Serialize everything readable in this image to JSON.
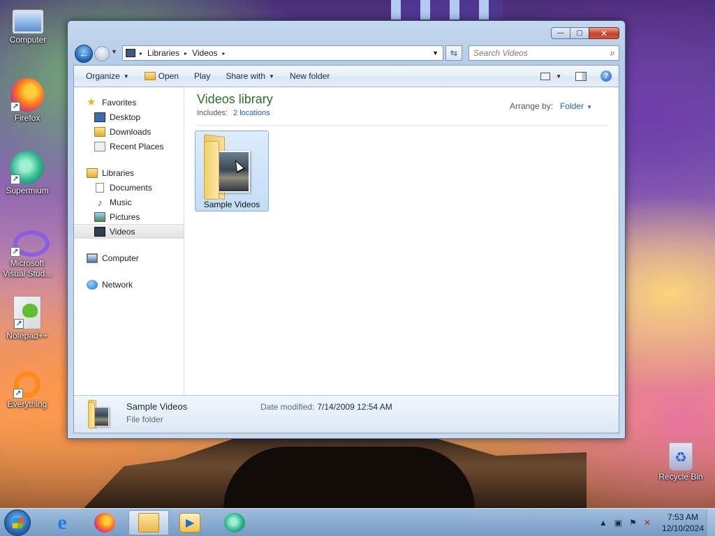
{
  "desktop": {
    "icons": [
      {
        "label": "Computer",
        "icon": "computer-icon"
      },
      {
        "label": "Firefox",
        "icon": "firefox-icon"
      },
      {
        "label": "Supermium",
        "icon": "supermium-icon"
      },
      {
        "label": "Microsoft Visual Stud...",
        "icon": "visual-studio-icon"
      },
      {
        "label": "Notepad++",
        "icon": "notepadpp-icon"
      },
      {
        "label": "Everything",
        "icon": "everything-icon"
      },
      {
        "label": "Recycle Bin",
        "icon": "recycle-bin-icon"
      }
    ]
  },
  "window": {
    "caption_buttons": {
      "minimize": "—",
      "maximize": "▢",
      "close": "✕"
    },
    "address": {
      "crumbs": [
        "Libraries",
        "Videos"
      ],
      "separator": "▸"
    },
    "search": {
      "placeholder": "Search Videos"
    },
    "toolbar": {
      "organize": "Organize",
      "open": "Open",
      "play": "Play",
      "share_with": "Share with",
      "new_folder": "New folder"
    },
    "nav": {
      "favorites": {
        "label": "Favorites",
        "items": [
          "Desktop",
          "Downloads",
          "Recent Places"
        ]
      },
      "libraries": {
        "label": "Libraries",
        "items": [
          "Documents",
          "Music",
          "Pictures",
          "Videos"
        ]
      },
      "computer": "Computer",
      "network": "Network",
      "selected": "Videos"
    },
    "library": {
      "title": "Videos library",
      "includes_label": "Includes:",
      "includes_link": "2 locations",
      "arrange_label": "Arrange by:",
      "arrange_value": "Folder"
    },
    "items": [
      {
        "name": "Sample Videos",
        "selected": true
      }
    ],
    "details": {
      "name": "Sample Videos",
      "date_label": "Date modified:",
      "date_value": "7/14/2009 12:54 AM",
      "type": "File folder"
    }
  },
  "taskbar": {
    "apps": [
      "internet-explorer-icon",
      "firefox-icon",
      "windows-explorer-icon",
      "media-player-icon",
      "supermium-icon"
    ],
    "active_app": "windows-explorer-icon",
    "clock": {
      "time": "7:53 AM",
      "date": "12/10/2024"
    }
  },
  "colors": {
    "library_title": "#2c6e2a",
    "link": "#1a5ec5",
    "window_frame": "#c4d8ee",
    "close_button": "#c2412a",
    "selection": "#c4ddf6"
  }
}
